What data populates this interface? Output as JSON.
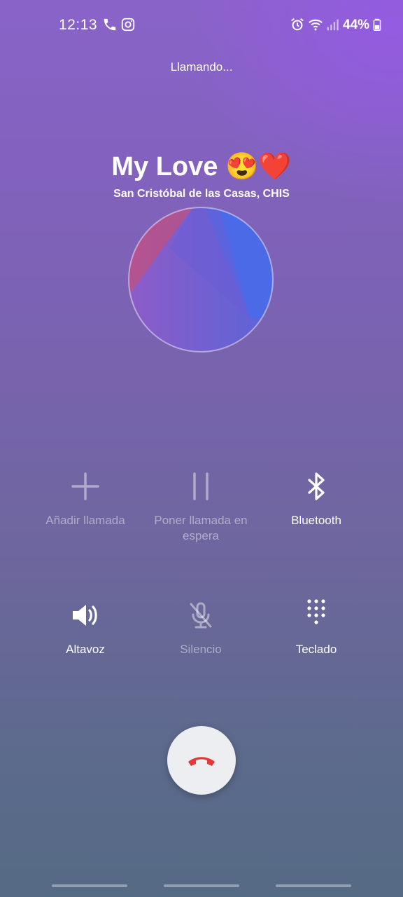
{
  "status_bar": {
    "time": "12:13",
    "battery": "44%",
    "left_icons": [
      "phone-icon",
      "instagram-icon"
    ],
    "right_icons": [
      "alarm-icon",
      "wifi-icon",
      "signal-icon",
      "battery-icon"
    ]
  },
  "call": {
    "status": "Llamando...",
    "contact_name": "My Love 😍❤️",
    "location": "San Cristóbal de las Casas, CHIS"
  },
  "controls": [
    {
      "label": "Añadir llamada",
      "icon": "plus-icon",
      "enabled": false
    },
    {
      "label": "Poner llamada en espera",
      "icon": "pause-icon",
      "enabled": false
    },
    {
      "label": "Bluetooth",
      "icon": "bluetooth-icon",
      "enabled": true
    },
    {
      "label": "Altavoz",
      "icon": "speaker-icon",
      "enabled": true
    },
    {
      "label": "Silencio",
      "icon": "mic-off-icon",
      "enabled": false
    },
    {
      "label": "Teclado",
      "icon": "keypad-icon",
      "enabled": true
    }
  ],
  "end_call": {
    "icon": "end-call-icon",
    "color": "#e53935"
  },
  "colors": {
    "background_top": "#8a63c9",
    "background_bottom": "#556a84",
    "end_call_bg": "#eceef2"
  }
}
